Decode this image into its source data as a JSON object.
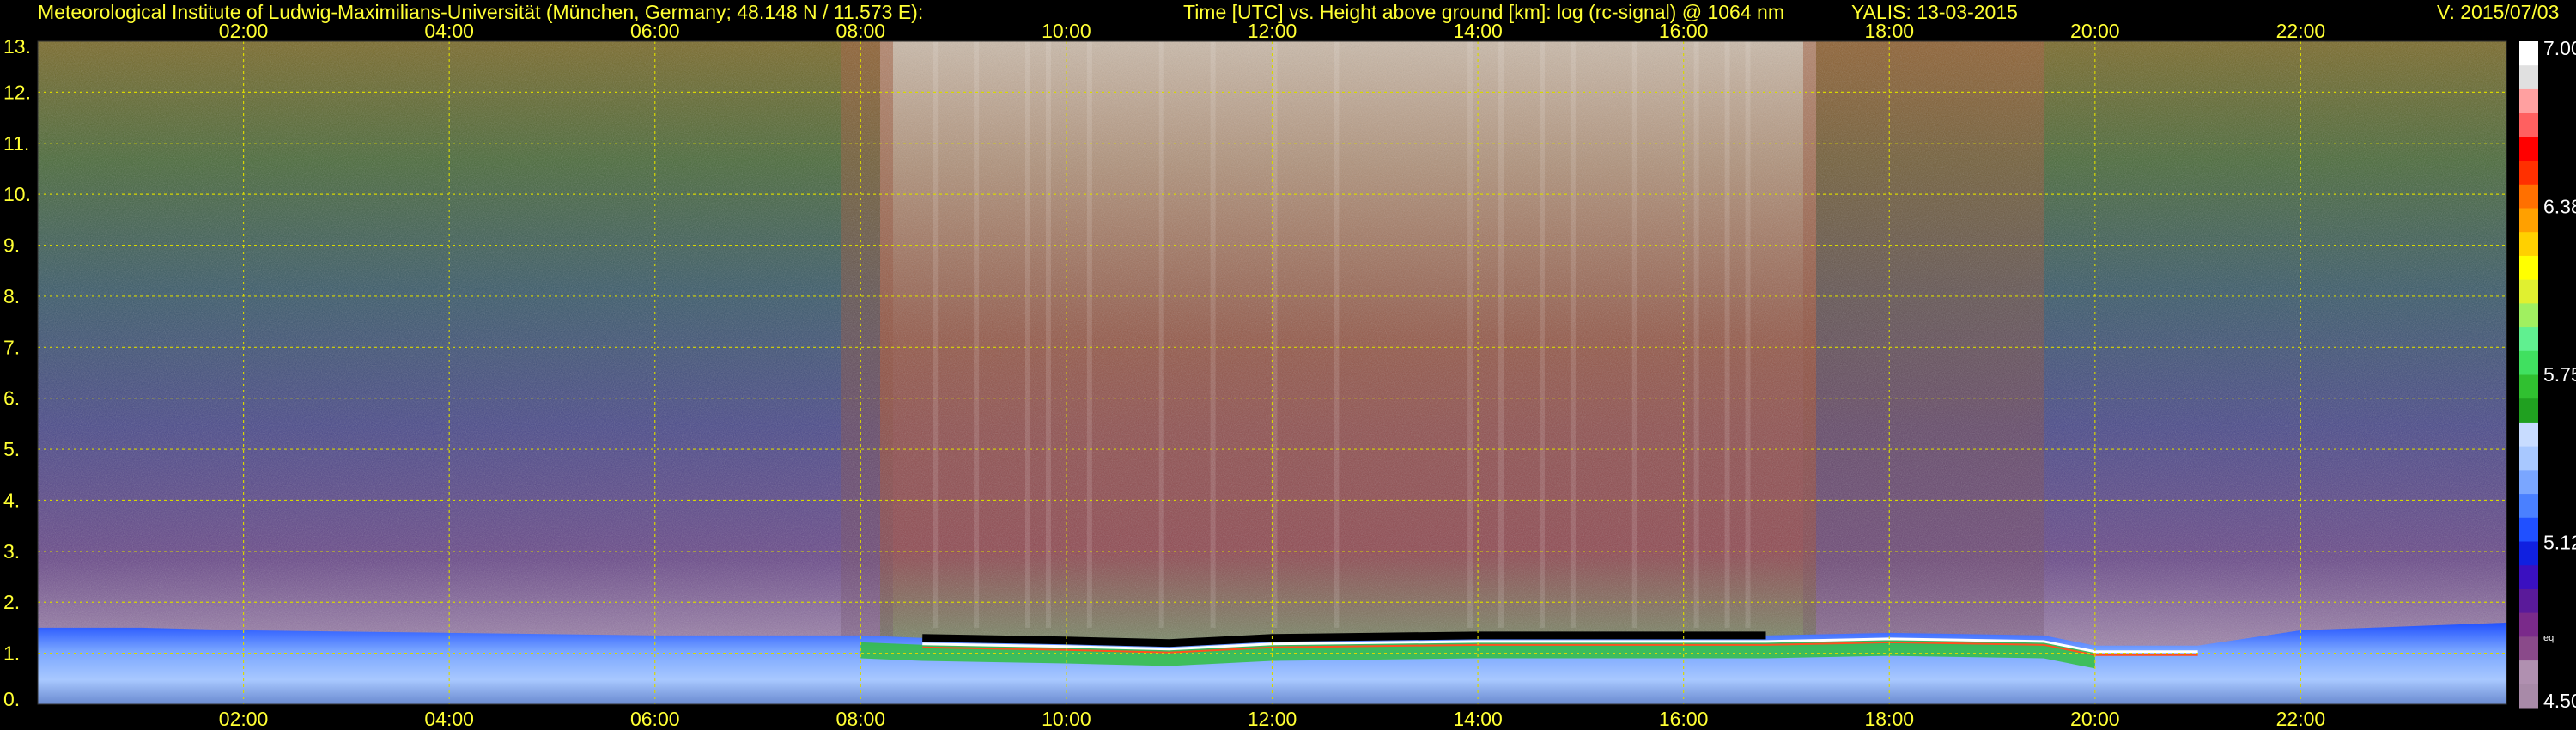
{
  "header": {
    "institute": "Meteorological Institute of Ludwig-Maximilians-Universität (München, Germany; 48.148 N / 11.573 E):",
    "axes_desc": "Time [UTC] vs. Height above ground [km]: log (rc-signal) @ 1064 nm",
    "station_date": "YALIS: 13-03-2015",
    "version": "V: 2015/07/03"
  },
  "colors": {
    "text": "#ffff33",
    "grid": "#d8d800",
    "background": "#000000"
  },
  "chart_data": {
    "type": "heatmap",
    "title": "Time [UTC] vs. Height above ground [km]: log (rc-signal) @ 1064 nm",
    "xlabel": "Time [UTC]",
    "ylabel": "Height above ground [km]",
    "xlim": [
      0,
      24
    ],
    "ylim": [
      0,
      13
    ],
    "x_ticks": [
      "02:00",
      "04:00",
      "06:00",
      "08:00",
      "10:00",
      "12:00",
      "14:00",
      "16:00",
      "18:00",
      "20:00",
      "22:00"
    ],
    "x_tick_values": [
      2,
      4,
      6,
      8,
      10,
      12,
      14,
      16,
      18,
      20,
      22
    ],
    "y_ticks": [
      "0.",
      "1.",
      "2.",
      "3.",
      "4.",
      "5.",
      "6.",
      "7.",
      "8.",
      "9.",
      "10.",
      "11.",
      "12.",
      "13."
    ],
    "y_tick_values": [
      0,
      1,
      2,
      3,
      4,
      5,
      6,
      7,
      8,
      9,
      10,
      11,
      12,
      13
    ],
    "grid": true,
    "colorbar": {
      "min": 4.5,
      "max": 7.0,
      "tick_labels": [
        "7.00",
        "6.38",
        "5.75",
        "5.12",
        "4.50"
      ],
      "tick_values": [
        7.0,
        6.38,
        5.75,
        5.12,
        4.5
      ],
      "small_label": "eq",
      "colors": [
        "#a88aa8",
        "#b090b0",
        "#8a4a8a",
        "#7a2a8a",
        "#5a1a9a",
        "#3a10c0",
        "#1020e0",
        "#2050ff",
        "#4a80ff",
        "#7aa6ff",
        "#a8c8ff",
        "#c8dcff",
        "#20a020",
        "#30c030",
        "#40e060",
        "#60f090",
        "#a0f060",
        "#e0f030",
        "#ffff00",
        "#ffd000",
        "#ffa000",
        "#ff7000",
        "#ff3000",
        "#ff0000",
        "#ff6060",
        "#ffa0a0",
        "#e0e0e0",
        "#ffffff"
      ]
    },
    "boundary_layer_top_km": [
      {
        "x": 0.0,
        "y": 1.5
      },
      {
        "x": 1.0,
        "y": 1.5
      },
      {
        "x": 2.0,
        "y": 1.45
      },
      {
        "x": 4.0,
        "y": 1.4
      },
      {
        "x": 6.0,
        "y": 1.35
      },
      {
        "x": 8.0,
        "y": 1.35
      },
      {
        "x": 8.6,
        "y": 1.3
      },
      {
        "x": 10.0,
        "y": 1.25
      },
      {
        "x": 11.0,
        "y": 1.2
      },
      {
        "x": 12.0,
        "y": 1.3
      },
      {
        "x": 14.0,
        "y": 1.35
      },
      {
        "x": 16.0,
        "y": 1.35
      },
      {
        "x": 16.8,
        "y": 1.35
      },
      {
        "x": 18.0,
        "y": 1.4
      },
      {
        "x": 19.5,
        "y": 1.35
      },
      {
        "x": 20.0,
        "y": 1.15
      },
      {
        "x": 21.0,
        "y": 1.15
      },
      {
        "x": 22.0,
        "y": 1.45
      },
      {
        "x": 24.0,
        "y": 1.6
      }
    ]
  }
}
